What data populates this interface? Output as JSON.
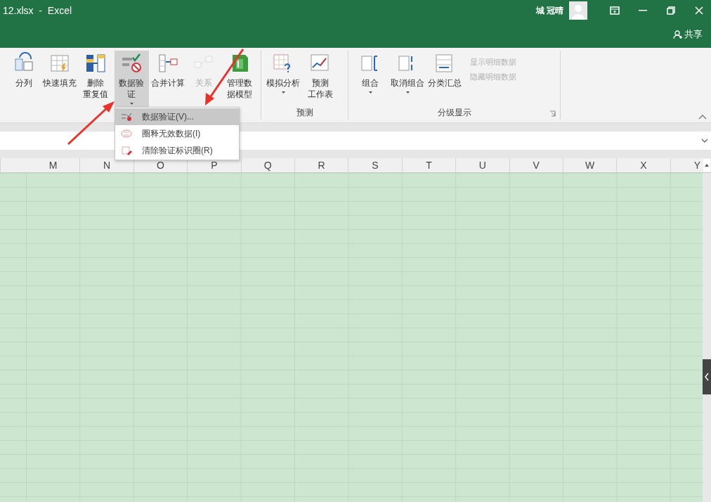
{
  "window": {
    "title": "12.xlsx  -  Excel",
    "user": "城 冠晴",
    "share_label": "共享"
  },
  "ribbon": {
    "groups": [
      {
        "buttons": [
          {
            "kind": "split",
            "lines": [
              "分列"
            ],
            "pressed": false,
            "disabled": false,
            "dropdown": false
          },
          {
            "kind": "flash",
            "lines": [
              "快速填充"
            ],
            "pressed": false,
            "disabled": false,
            "dropdown": false
          },
          {
            "kind": "dedupe",
            "lines": [
              "删除",
              "重复值"
            ],
            "pressed": false,
            "disabled": false,
            "dropdown": false
          },
          {
            "kind": "validate",
            "lines": [
              "数据验",
              "证"
            ],
            "pressed": true,
            "disabled": false,
            "dropdown": true
          },
          {
            "kind": "consolidate",
            "lines": [
              "合并计算"
            ],
            "pressed": false,
            "disabled": false,
            "dropdown": false
          },
          {
            "kind": "relation",
            "lines": [
              "关系"
            ],
            "pressed": false,
            "disabled": true,
            "dropdown": false
          },
          {
            "kind": "model",
            "lines": [
              "管理数",
              "据模型"
            ],
            "pressed": false,
            "disabled": false,
            "dropdown": false
          }
        ]
      },
      {
        "label": "预测",
        "buttons": [
          {
            "kind": "whatif",
            "lines": [
              "模拟分析"
            ],
            "pressed": false,
            "disabled": false,
            "dropdown": true
          },
          {
            "kind": "forecast",
            "lines": [
              "预测",
              "工作表"
            ],
            "pressed": false,
            "disabled": false,
            "dropdown": false
          }
        ]
      },
      {
        "label": "分级显示",
        "buttons": [
          {
            "kind": "group",
            "lines": [
              "组合"
            ],
            "pressed": false,
            "disabled": false,
            "dropdown": true
          },
          {
            "kind": "ungroup",
            "lines": [
              "取消组合"
            ],
            "pressed": false,
            "disabled": false,
            "dropdown": true
          },
          {
            "kind": "subtotal",
            "lines": [
              "分类汇总"
            ],
            "pressed": false,
            "disabled": false,
            "dropdown": false
          }
        ],
        "small_buttons": [
          {
            "label": "显示明细数据",
            "disabled": true
          },
          {
            "label": "隐藏明细数据",
            "disabled": true
          }
        ]
      }
    ]
  },
  "menu": {
    "items": [
      {
        "label": "数据验证(V)...",
        "selected": true,
        "disabled": false
      },
      {
        "label": "圈释无效数据(I)",
        "selected": false,
        "disabled": false
      },
      {
        "label": "清除验证标识圈(R)",
        "selected": false,
        "disabled": false
      }
    ]
  },
  "sheet": {
    "columns": [
      "M",
      "N",
      "O",
      "P",
      "Q",
      "R",
      "S",
      "T",
      "U",
      "V",
      "W",
      "X",
      "Y"
    ]
  }
}
